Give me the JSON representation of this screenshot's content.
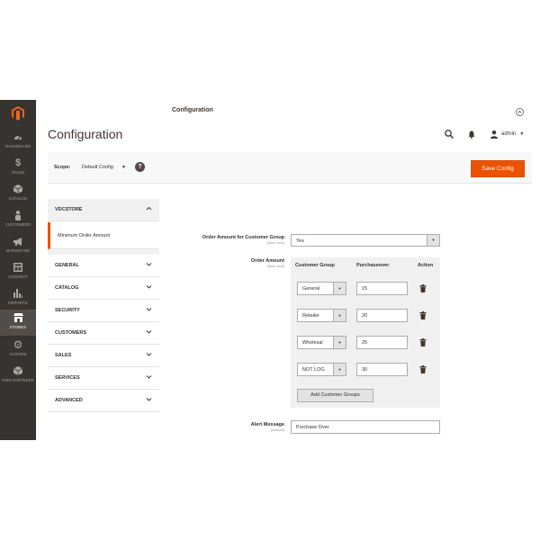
{
  "nav": {
    "items": [
      {
        "label": "DASHBOARD",
        "icon": "dashboard-icon"
      },
      {
        "label": "SALES",
        "icon": "dollar-icon"
      },
      {
        "label": "CATALOG",
        "icon": "cube-icon"
      },
      {
        "label": "CUSTOMERS",
        "icon": "person-icon"
      },
      {
        "label": "MARKETING",
        "icon": "megaphone-icon"
      },
      {
        "label": "CONTENT",
        "icon": "layout-icon"
      },
      {
        "label": "REPORTS",
        "icon": "bar-chart-icon"
      },
      {
        "label": "STORES",
        "icon": "store-icon"
      },
      {
        "label": "SYSTEM",
        "icon": "gear-icon"
      },
      {
        "label": "FIND PARTNERS",
        "icon": "partners-cube-icon"
      }
    ],
    "active_index": 7
  },
  "header": {
    "title": "Configuration",
    "user": "admin"
  },
  "scope": {
    "label": "Scope:",
    "value": "Default Config",
    "help": "?",
    "save_label": "Save Config"
  },
  "tabs": {
    "group_title": "VDCSTORE",
    "active_item": "Minimum Order Amount",
    "sections": [
      "GENERAL",
      "CATALOG",
      "SECURITY",
      "CUSTOMERS",
      "SALES",
      "SERVICES",
      "ADVANCED"
    ]
  },
  "section": {
    "title": "Configuration"
  },
  "fields": {
    "order_group": {
      "label": "Order Amount for Customer Group",
      "scope": "[store view]",
      "value": "Yes"
    },
    "order_amount": {
      "label": "Order Amount",
      "scope": "[store view]",
      "columns": [
        "Customer Group",
        "Purchaseover",
        "Action"
      ],
      "rows": [
        {
          "group": "General",
          "amount": "15"
        },
        {
          "group": "Retailer",
          "amount": "20"
        },
        {
          "group": "Wholesal",
          "amount": "25"
        },
        {
          "group": "NOT LOG",
          "amount": "30"
        }
      ],
      "add_label": "Add Customer Groups"
    },
    "alert_message": {
      "label": "Alert Message",
      "scope": "[website]",
      "value": "Purchase Over"
    }
  },
  "colors": {
    "nav_bg": "#373330",
    "accent": "#eb5202"
  }
}
